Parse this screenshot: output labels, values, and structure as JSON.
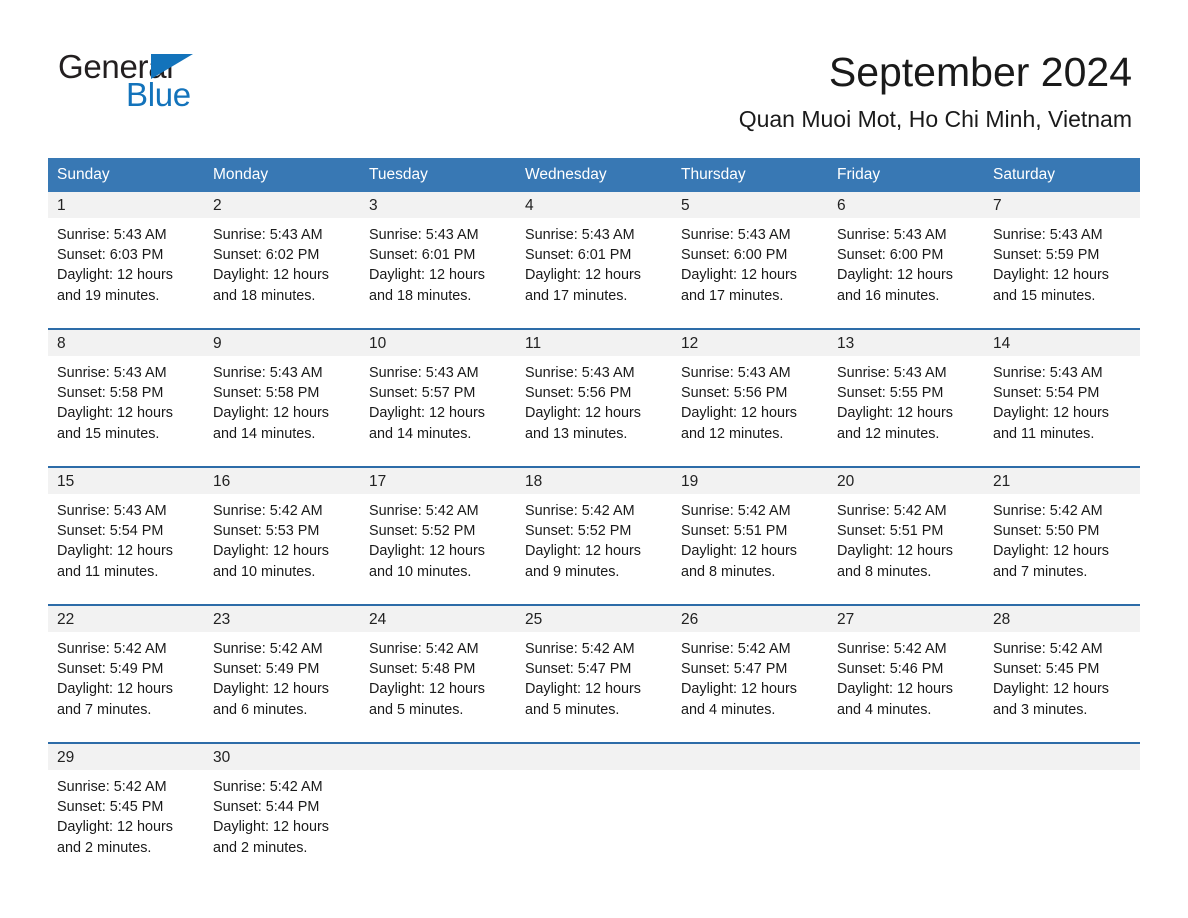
{
  "brand": {
    "name_part1": "General",
    "name_part2": "Blue",
    "triangle_color": "#1373bb"
  },
  "header": {
    "title": "September 2024",
    "subtitle": "Quan Muoi Mot, Ho Chi Minh, Vietnam"
  },
  "colors": {
    "header_row_bg": "#3878b4",
    "week_divider": "#2d6ca8",
    "day_number_bg": "#f2f2f2",
    "text": "#1a1a1a"
  },
  "weekdays": [
    "Sunday",
    "Monday",
    "Tuesday",
    "Wednesday",
    "Thursday",
    "Friday",
    "Saturday"
  ],
  "labels": {
    "sunrise_prefix": "Sunrise:",
    "sunset_prefix": "Sunset:",
    "daylight_prefix": "Daylight:"
  },
  "weeks": [
    [
      {
        "day": "1",
        "sunrise": "Sunrise: 5:43 AM",
        "sunset": "Sunset: 6:03 PM",
        "daylight_line1": "Daylight: 12 hours",
        "daylight_line2": "and 19 minutes."
      },
      {
        "day": "2",
        "sunrise": "Sunrise: 5:43 AM",
        "sunset": "Sunset: 6:02 PM",
        "daylight_line1": "Daylight: 12 hours",
        "daylight_line2": "and 18 minutes."
      },
      {
        "day": "3",
        "sunrise": "Sunrise: 5:43 AM",
        "sunset": "Sunset: 6:01 PM",
        "daylight_line1": "Daylight: 12 hours",
        "daylight_line2": "and 18 minutes."
      },
      {
        "day": "4",
        "sunrise": "Sunrise: 5:43 AM",
        "sunset": "Sunset: 6:01 PM",
        "daylight_line1": "Daylight: 12 hours",
        "daylight_line2": "and 17 minutes."
      },
      {
        "day": "5",
        "sunrise": "Sunrise: 5:43 AM",
        "sunset": "Sunset: 6:00 PM",
        "daylight_line1": "Daylight: 12 hours",
        "daylight_line2": "and 17 minutes."
      },
      {
        "day": "6",
        "sunrise": "Sunrise: 5:43 AM",
        "sunset": "Sunset: 6:00 PM",
        "daylight_line1": "Daylight: 12 hours",
        "daylight_line2": "and 16 minutes."
      },
      {
        "day": "7",
        "sunrise": "Sunrise: 5:43 AM",
        "sunset": "Sunset: 5:59 PM",
        "daylight_line1": "Daylight: 12 hours",
        "daylight_line2": "and 15 minutes."
      }
    ],
    [
      {
        "day": "8",
        "sunrise": "Sunrise: 5:43 AM",
        "sunset": "Sunset: 5:58 PM",
        "daylight_line1": "Daylight: 12 hours",
        "daylight_line2": "and 15 minutes."
      },
      {
        "day": "9",
        "sunrise": "Sunrise: 5:43 AM",
        "sunset": "Sunset: 5:58 PM",
        "daylight_line1": "Daylight: 12 hours",
        "daylight_line2": "and 14 minutes."
      },
      {
        "day": "10",
        "sunrise": "Sunrise: 5:43 AM",
        "sunset": "Sunset: 5:57 PM",
        "daylight_line1": "Daylight: 12 hours",
        "daylight_line2": "and 14 minutes."
      },
      {
        "day": "11",
        "sunrise": "Sunrise: 5:43 AM",
        "sunset": "Sunset: 5:56 PM",
        "daylight_line1": "Daylight: 12 hours",
        "daylight_line2": "and 13 minutes."
      },
      {
        "day": "12",
        "sunrise": "Sunrise: 5:43 AM",
        "sunset": "Sunset: 5:56 PM",
        "daylight_line1": "Daylight: 12 hours",
        "daylight_line2": "and 12 minutes."
      },
      {
        "day": "13",
        "sunrise": "Sunrise: 5:43 AM",
        "sunset": "Sunset: 5:55 PM",
        "daylight_line1": "Daylight: 12 hours",
        "daylight_line2": "and 12 minutes."
      },
      {
        "day": "14",
        "sunrise": "Sunrise: 5:43 AM",
        "sunset": "Sunset: 5:54 PM",
        "daylight_line1": "Daylight: 12 hours",
        "daylight_line2": "and 11 minutes."
      }
    ],
    [
      {
        "day": "15",
        "sunrise": "Sunrise: 5:43 AM",
        "sunset": "Sunset: 5:54 PM",
        "daylight_line1": "Daylight: 12 hours",
        "daylight_line2": "and 11 minutes."
      },
      {
        "day": "16",
        "sunrise": "Sunrise: 5:42 AM",
        "sunset": "Sunset: 5:53 PM",
        "daylight_line1": "Daylight: 12 hours",
        "daylight_line2": "and 10 minutes."
      },
      {
        "day": "17",
        "sunrise": "Sunrise: 5:42 AM",
        "sunset": "Sunset: 5:52 PM",
        "daylight_line1": "Daylight: 12 hours",
        "daylight_line2": "and 10 minutes."
      },
      {
        "day": "18",
        "sunrise": "Sunrise: 5:42 AM",
        "sunset": "Sunset: 5:52 PM",
        "daylight_line1": "Daylight: 12 hours",
        "daylight_line2": "and 9 minutes."
      },
      {
        "day": "19",
        "sunrise": "Sunrise: 5:42 AM",
        "sunset": "Sunset: 5:51 PM",
        "daylight_line1": "Daylight: 12 hours",
        "daylight_line2": "and 8 minutes."
      },
      {
        "day": "20",
        "sunrise": "Sunrise: 5:42 AM",
        "sunset": "Sunset: 5:51 PM",
        "daylight_line1": "Daylight: 12 hours",
        "daylight_line2": "and 8 minutes."
      },
      {
        "day": "21",
        "sunrise": "Sunrise: 5:42 AM",
        "sunset": "Sunset: 5:50 PM",
        "daylight_line1": "Daylight: 12 hours",
        "daylight_line2": "and 7 minutes."
      }
    ],
    [
      {
        "day": "22",
        "sunrise": "Sunrise: 5:42 AM",
        "sunset": "Sunset: 5:49 PM",
        "daylight_line1": "Daylight: 12 hours",
        "daylight_line2": "and 7 minutes."
      },
      {
        "day": "23",
        "sunrise": "Sunrise: 5:42 AM",
        "sunset": "Sunset: 5:49 PM",
        "daylight_line1": "Daylight: 12 hours",
        "daylight_line2": "and 6 minutes."
      },
      {
        "day": "24",
        "sunrise": "Sunrise: 5:42 AM",
        "sunset": "Sunset: 5:48 PM",
        "daylight_line1": "Daylight: 12 hours",
        "daylight_line2": "and 5 minutes."
      },
      {
        "day": "25",
        "sunrise": "Sunrise: 5:42 AM",
        "sunset": "Sunset: 5:47 PM",
        "daylight_line1": "Daylight: 12 hours",
        "daylight_line2": "and 5 minutes."
      },
      {
        "day": "26",
        "sunrise": "Sunrise: 5:42 AM",
        "sunset": "Sunset: 5:47 PM",
        "daylight_line1": "Daylight: 12 hours",
        "daylight_line2": "and 4 minutes."
      },
      {
        "day": "27",
        "sunrise": "Sunrise: 5:42 AM",
        "sunset": "Sunset: 5:46 PM",
        "daylight_line1": "Daylight: 12 hours",
        "daylight_line2": "and 4 minutes."
      },
      {
        "day": "28",
        "sunrise": "Sunrise: 5:42 AM",
        "sunset": "Sunset: 5:45 PM",
        "daylight_line1": "Daylight: 12 hours",
        "daylight_line2": "and 3 minutes."
      }
    ],
    [
      {
        "day": "29",
        "sunrise": "Sunrise: 5:42 AM",
        "sunset": "Sunset: 5:45 PM",
        "daylight_line1": "Daylight: 12 hours",
        "daylight_line2": "and 2 minutes."
      },
      {
        "day": "30",
        "sunrise": "Sunrise: 5:42 AM",
        "sunset": "Sunset: 5:44 PM",
        "daylight_line1": "Daylight: 12 hours",
        "daylight_line2": "and 2 minutes."
      },
      {
        "day": "",
        "sunrise": "",
        "sunset": "",
        "daylight_line1": "",
        "daylight_line2": ""
      },
      {
        "day": "",
        "sunrise": "",
        "sunset": "",
        "daylight_line1": "",
        "daylight_line2": ""
      },
      {
        "day": "",
        "sunrise": "",
        "sunset": "",
        "daylight_line1": "",
        "daylight_line2": ""
      },
      {
        "day": "",
        "sunrise": "",
        "sunset": "",
        "daylight_line1": "",
        "daylight_line2": ""
      },
      {
        "day": "",
        "sunrise": "",
        "sunset": "",
        "daylight_line1": "",
        "daylight_line2": ""
      }
    ]
  ]
}
